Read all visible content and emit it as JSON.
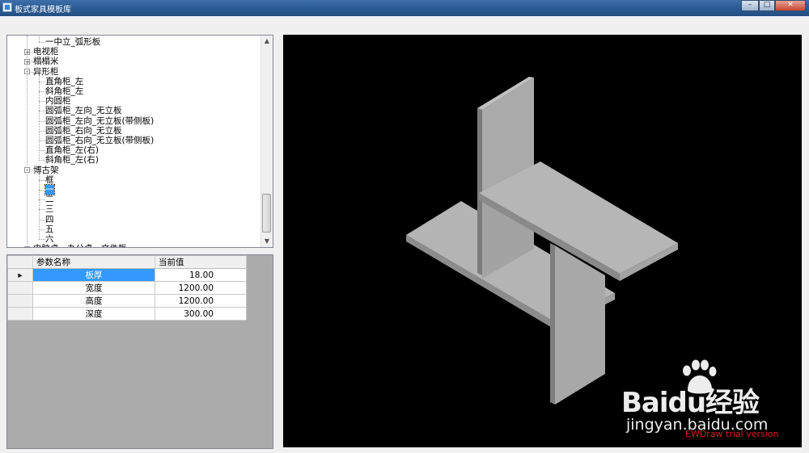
{
  "window": {
    "title": "板式家具模板库",
    "buttons": {
      "minimize": "–",
      "maximize": "□",
      "close": "✕"
    }
  },
  "tree": {
    "nodes": [
      {
        "label": "一中立_弧形板",
        "level": 2,
        "expander": ""
      },
      {
        "label": "电视柜",
        "level": 1,
        "expander": "+"
      },
      {
        "label": "榻榻米",
        "level": 1,
        "expander": "+"
      },
      {
        "label": "异形柜",
        "level": 1,
        "expander": "-"
      },
      {
        "label": "直角柜_左",
        "level": 2,
        "expander": ""
      },
      {
        "label": "斜角柜_左",
        "level": 2,
        "expander": ""
      },
      {
        "label": "内圆柜",
        "level": 2,
        "expander": ""
      },
      {
        "label": "圆弧柜_左向_无立板",
        "level": 2,
        "expander": ""
      },
      {
        "label": "圆弧柜_左向_无立板(带侧板)",
        "level": 2,
        "expander": ""
      },
      {
        "label": "圆弧柜_右向_无立板",
        "level": 2,
        "expander": ""
      },
      {
        "label": "圆弧柜_右向_无立板(带侧板)",
        "level": 2,
        "expander": ""
      },
      {
        "label": "直角柜_左(右)",
        "level": 2,
        "expander": ""
      },
      {
        "label": "斜角柜_左(右)",
        "level": 2,
        "expander": ""
      },
      {
        "label": "博古架",
        "level": 1,
        "expander": "-"
      },
      {
        "label": "框",
        "level": 2,
        "expander": ""
      },
      {
        "label": "一",
        "level": 2,
        "expander": "",
        "selected": true
      },
      {
        "label": "二",
        "level": 2,
        "expander": ""
      },
      {
        "label": "三",
        "level": 2,
        "expander": ""
      },
      {
        "label": "四",
        "level": 2,
        "expander": ""
      },
      {
        "label": "五",
        "level": 2,
        "expander": ""
      },
      {
        "label": "六",
        "level": 2,
        "expander": ""
      },
      {
        "label": "电脑桌，办公桌，文件柜",
        "level": 1,
        "expander": "+"
      }
    ],
    "scroll_up": "▲",
    "scroll_down": "▼"
  },
  "params": {
    "headers": [
      "参数名称",
      "当前值"
    ],
    "current_row_marker": "▸",
    "rows": [
      {
        "name": "板厚",
        "value": "18.00"
      },
      {
        "name": "宽度",
        "value": "1200.00"
      },
      {
        "name": "高度",
        "value": "1200.00"
      },
      {
        "name": "深度",
        "value": "300.00"
      }
    ]
  },
  "viewport": {
    "trial_text": "EWDraw trial version",
    "watermark_main": "Baidu经验",
    "watermark_sub": "jingyan.baidu.com"
  },
  "colors": {
    "panel_top": "#b4b4b4",
    "panel_left": "#8c8c8c",
    "panel_right": "#a6a6a6",
    "viewport_bg": "#000000",
    "selection": "#3399ff"
  }
}
